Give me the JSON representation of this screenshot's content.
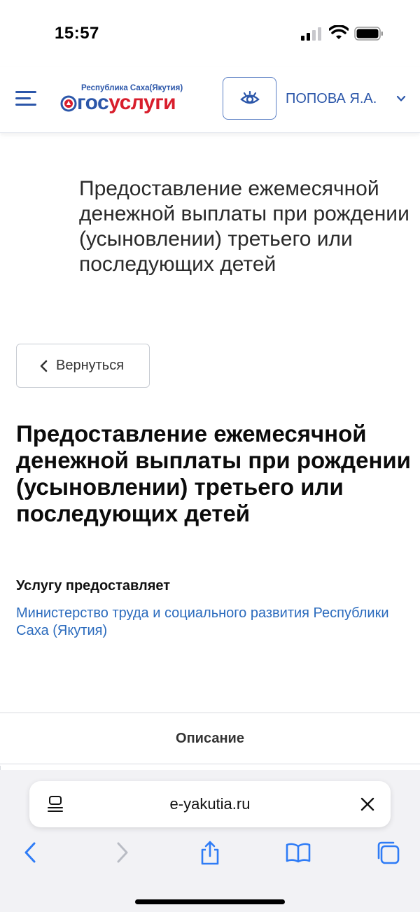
{
  "status_bar": {
    "time": "15:57"
  },
  "header": {
    "logo_region": "Республика Саха(Якутия)",
    "logo_gos": "гос",
    "logo_uslugi": "услуги",
    "user_name": "ПОПОВА Я.А."
  },
  "page": {
    "subtitle": "Предоставление ежемесячной денежной выплаты при рождении (усыновлении) третьего или последующих детей",
    "back_label": "Вернуться",
    "title": "Предоставление ежемесячной денежной выплаты при рождении (усыновлении) третьего или последующих детей",
    "provider_label": "Услугу предоставляет",
    "provider_name": "Министерство труда и социального развития Республики Саха (Якутия)",
    "tab_label": "Описание"
  },
  "browser": {
    "url": "e-yakutia.ru"
  },
  "colors": {
    "brand_blue": "#2b56a9",
    "brand_red": "#d81e2c",
    "link_blue": "#2b6bbd",
    "ios_blue": "#2f7cf6"
  }
}
